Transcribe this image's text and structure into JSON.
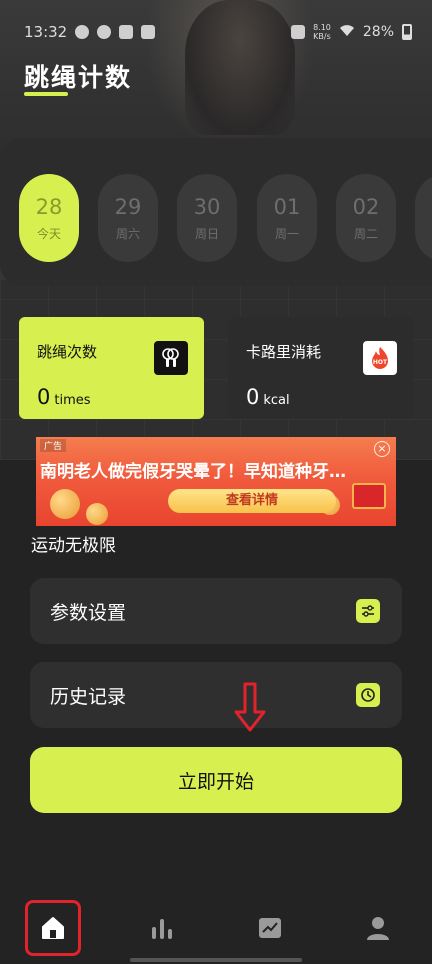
{
  "status_bar": {
    "time": "13:32",
    "net_speed_value": "8.10",
    "net_speed_unit": "KB/s",
    "battery": "28%"
  },
  "page": {
    "title": "跳绳计数"
  },
  "dates": [
    {
      "day": "28",
      "weekday": "今天",
      "active": true
    },
    {
      "day": "29",
      "weekday": "周六",
      "active": false
    },
    {
      "day": "30",
      "weekday": "周日",
      "active": false
    },
    {
      "day": "01",
      "weekday": "周一",
      "active": false
    },
    {
      "day": "02",
      "weekday": "周二",
      "active": false
    }
  ],
  "stats": {
    "jumps": {
      "label": "跳绳次数",
      "value": "0",
      "unit": "times",
      "icon": "jump-rope-icon"
    },
    "calories": {
      "label": "卡路里消耗",
      "value": "0",
      "unit": "kcal",
      "icon": "hot-flame-icon",
      "icon_text": "HOT"
    }
  },
  "ad": {
    "tag": "广告",
    "headline": "南明老人做完假牙哭晕了！早知道种牙…",
    "button": "查看详情",
    "close": "×"
  },
  "section": {
    "title": "运动无极限"
  },
  "menu": {
    "settings": {
      "label": "参数设置",
      "icon": "sliders-icon"
    },
    "history": {
      "label": "历史记录",
      "icon": "clock-icon"
    }
  },
  "start_button": {
    "label": "立即开始"
  },
  "nav": [
    {
      "name": "home",
      "icon": "home-icon",
      "active": true
    },
    {
      "name": "stats",
      "icon": "bar-chart-icon",
      "active": false
    },
    {
      "name": "trend",
      "icon": "trend-chart-icon",
      "active": false
    },
    {
      "name": "profile",
      "icon": "user-icon",
      "active": false
    }
  ],
  "colors": {
    "accent": "#d7f04f",
    "background": "#232323",
    "card": "#2f2f2f",
    "highlight": "#e3232c"
  }
}
